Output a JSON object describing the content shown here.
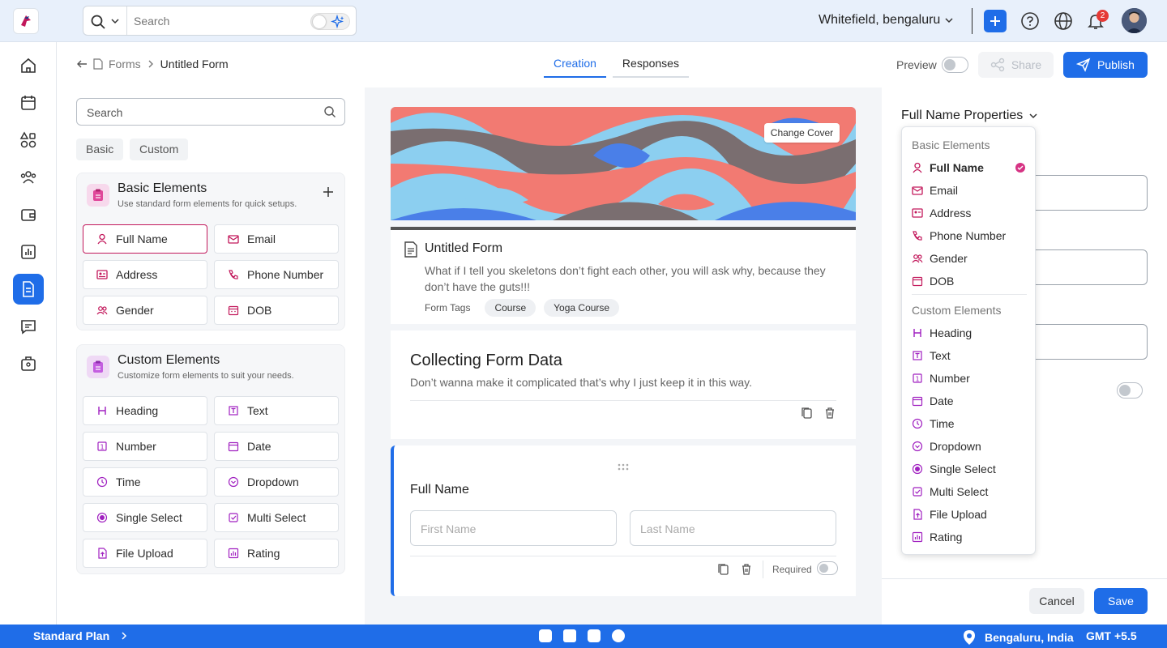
{
  "topbar": {
    "search_placeholder": "Search",
    "location": "Whitefield, bengaluru",
    "notification_count": "2"
  },
  "breadcrumb": {
    "parent": "Forms",
    "current": "Untitled Form"
  },
  "tabs": [
    {
      "label": "Creation",
      "active": true
    },
    {
      "label": "Responses",
      "active": false
    }
  ],
  "header_actions": {
    "preview_label": "Preview",
    "share_label": "Share",
    "publish_label": "Publish"
  },
  "left_panel": {
    "search_placeholder": "Search",
    "chips": [
      "Basic",
      "Custom"
    ],
    "basic": {
      "title": "Basic Elements",
      "subtitle": "Use standard form elements for quick setups.",
      "items": [
        "Full Name",
        "Email",
        "Address",
        "Phone Number",
        "Gender",
        "DOB"
      ]
    },
    "custom": {
      "title": "Custom Elements",
      "subtitle": "Customize form elements to suit your needs.",
      "items": [
        "Heading",
        "Text",
        "Number",
        "Date",
        "Time",
        "Dropdown",
        "Single Select",
        "Multi Select",
        "File Upload",
        "Rating"
      ]
    }
  },
  "canvas": {
    "change_cover": "Change Cover",
    "form_title": "Untitled Form",
    "form_description": "What if I tell you skeletons don’t fight each other, you will ask why, because they don’t have the guts!!!",
    "tags_label": "Form Tags",
    "tags": [
      "Course",
      "Yoga Course"
    ],
    "section_title": "Collecting Form Data",
    "section_description": "Don’t wanna make it complicated that’s why I just keep it in this way.",
    "field_label": "Full Name",
    "first_name_placeholder": "First Name",
    "last_name_placeholder": "Last Name",
    "required_label": "Required"
  },
  "right_panel": {
    "title": "Full Name Properties",
    "dropdown": {
      "basic_heading": "Basic Elements",
      "basic_items": [
        "Full Name",
        "Email",
        "Address",
        "Phone Number",
        "Gender",
        "DOB"
      ],
      "selected": "Full Name",
      "custom_heading": "Custom Elements",
      "custom_items": [
        "Heading",
        "Text",
        "Number",
        "Date",
        "Time",
        "Dropdown",
        "Single Select",
        "Multi Select",
        "File Upload",
        "Rating"
      ]
    },
    "cancel_label": "Cancel",
    "save_label": "Save"
  },
  "footer": {
    "plan": "Standard Plan",
    "location": "Bengaluru, India",
    "timezone": "GMT +5.5"
  },
  "colors": {
    "primary": "#1f6de8",
    "accent": "#c2185b"
  }
}
